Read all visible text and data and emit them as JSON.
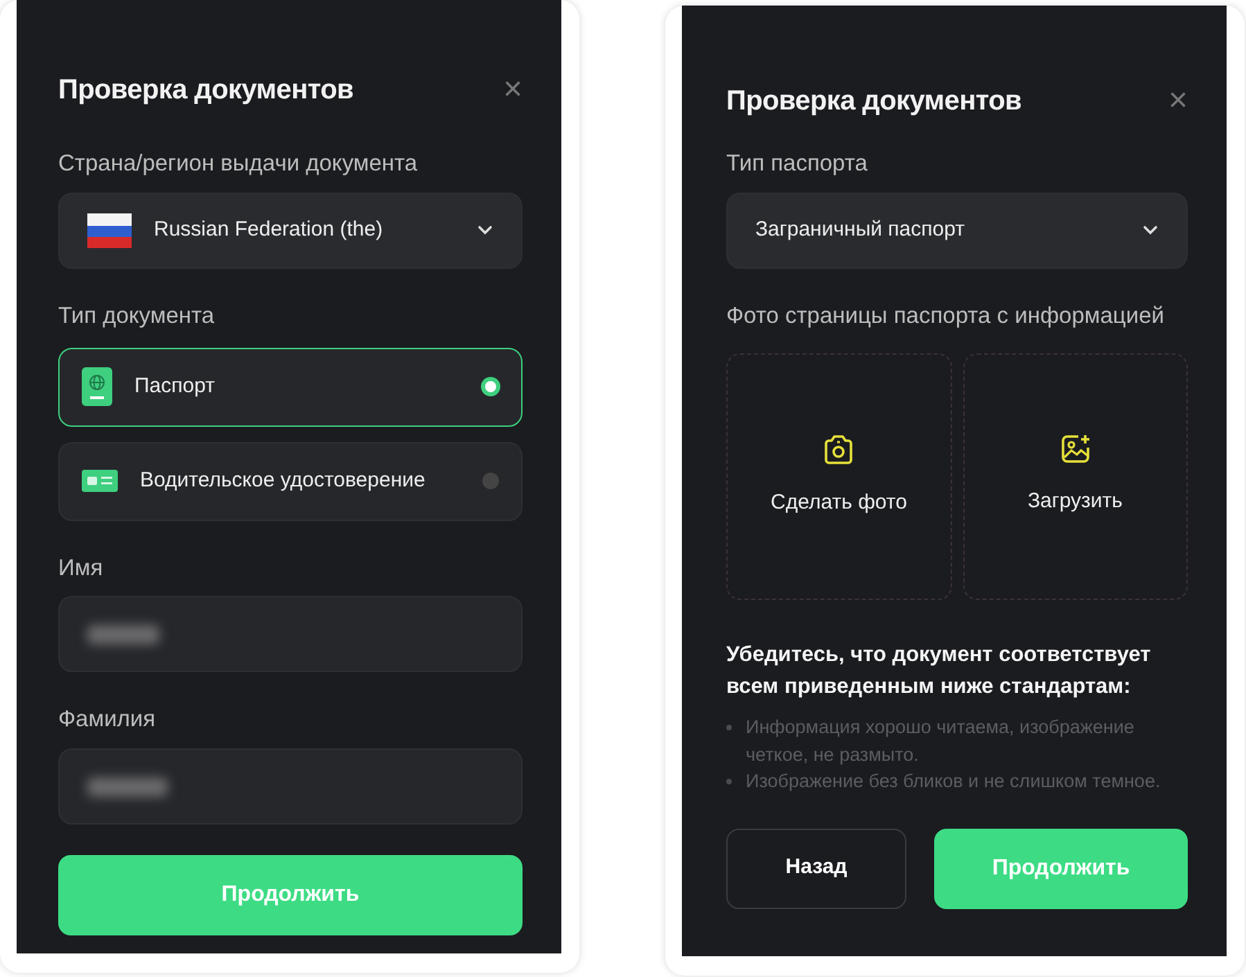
{
  "panels": [
    {
      "kind": "form",
      "title": "Проверка документов",
      "close": "×",
      "country": {
        "label": "Страна/регион выдачи документа",
        "value": "Russian Federation (the)"
      },
      "doc_type": {
        "label": "Тип документа",
        "options": [
          {
            "kind": "passport",
            "label": "Паспорт",
            "selected": true
          },
          {
            "kind": "license",
            "label": "Водительское удостоверение",
            "selected": false
          }
        ]
      },
      "fields": [
        {
          "label": "Имя",
          "blurred": true
        },
        {
          "label": "Фамилия",
          "blurred": true
        }
      ],
      "buttons": [
        {
          "kind": "primary",
          "label": "Продолжить"
        }
      ]
    },
    {
      "kind": "upload",
      "title": "Проверка документов",
      "close": "×",
      "passport_type": {
        "label": "Тип паспорта",
        "value": "Заграничный паспорт"
      },
      "photo": {
        "label": "Фото страницы паспорта с информацией",
        "tiles": [
          {
            "kind": "camera",
            "label": "Сделать фото"
          },
          {
            "kind": "gallery",
            "label": "Загрузить"
          }
        ]
      },
      "requirements": {
        "heading": "Убедитесь, что документ соответствует всем приведенным ниже стандартам:",
        "items": [
          "Информация хорошо читаема, изображение четкое, не размыто.",
          "Изображение без бликов и не слишком темное."
        ]
      },
      "buttons": [
        {
          "kind": "secondary",
          "label": "Назад"
        },
        {
          "kind": "primary",
          "label": "Продолжить"
        }
      ]
    }
  ]
}
